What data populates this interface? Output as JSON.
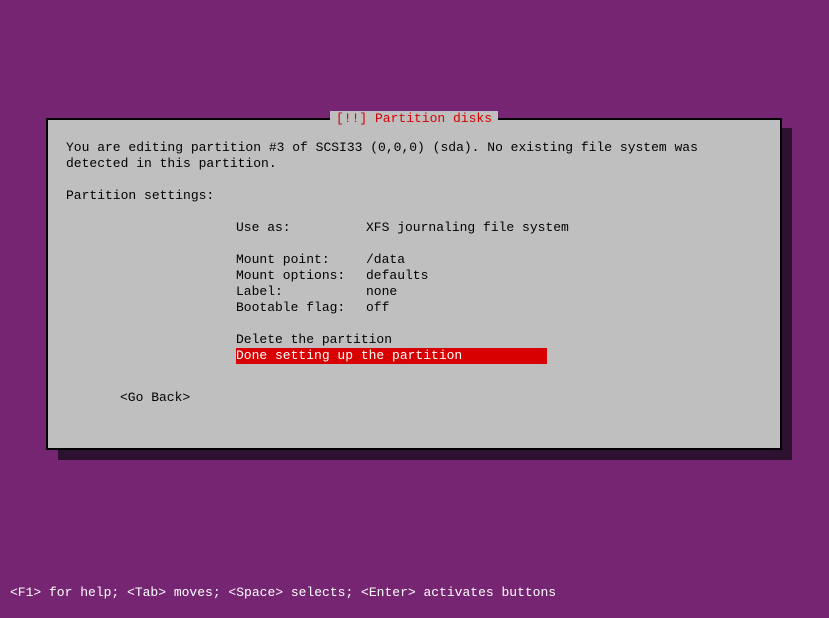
{
  "dialog": {
    "title": "[!!] Partition disks",
    "description": "You are editing partition #3 of SCSI33 (0,0,0) (sda). No existing file system was detected in this partition.",
    "settings_header": "Partition settings:",
    "settings": {
      "use_as_label": "Use as:",
      "use_as_value": "XFS journaling file system",
      "mount_point_label": "Mount point:",
      "mount_point_value": "/data",
      "mount_options_label": "Mount options:",
      "mount_options_value": "defaults",
      "label_label": "Label:",
      "label_value": "none",
      "bootable_flag_label": "Bootable flag:",
      "bootable_flag_value": "off"
    },
    "actions": {
      "delete": "Delete the partition",
      "done": "Done setting up the partition"
    },
    "go_back": "<Go Back>"
  },
  "helpbar": "<F1> for help; <Tab> moves; <Space> selects; <Enter> activates buttons"
}
